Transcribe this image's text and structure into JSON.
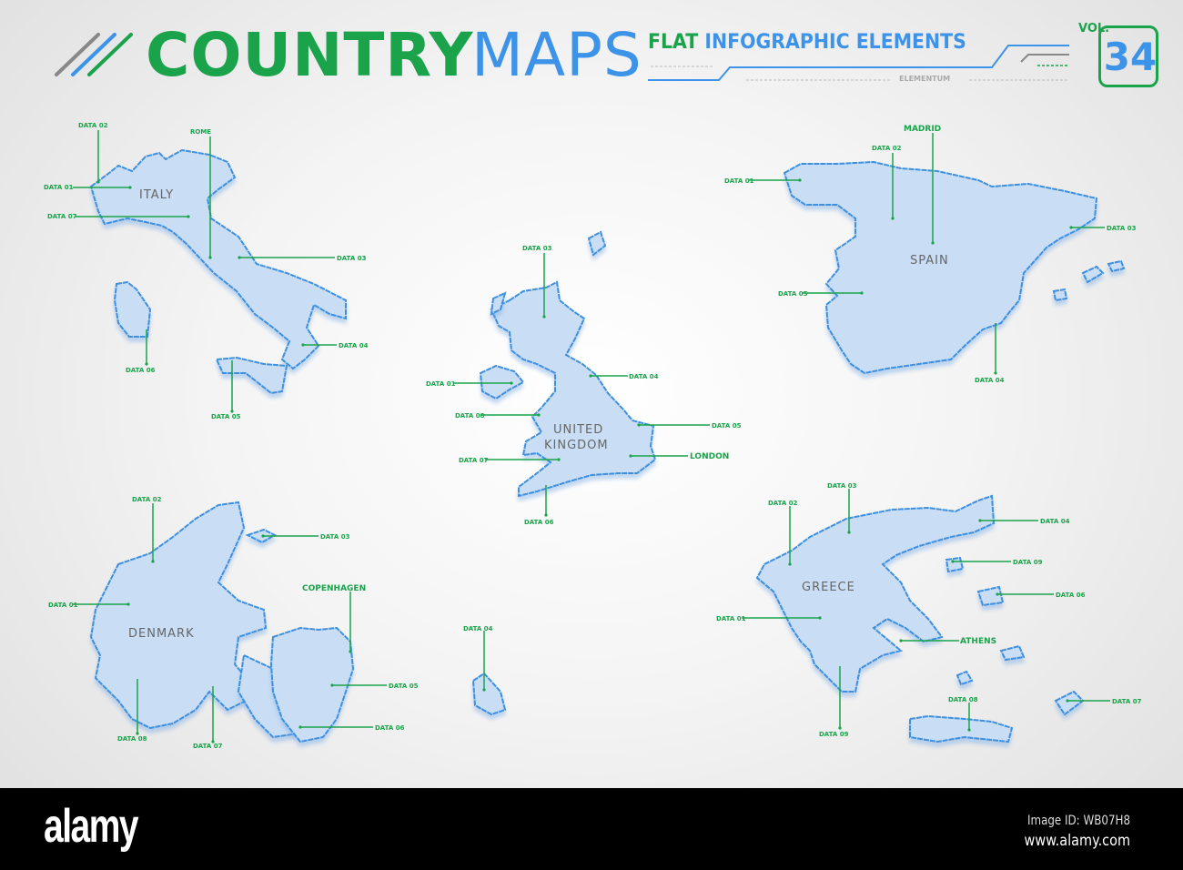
{
  "header": {
    "title_part1": "COUNTRY",
    "title_part2": "MAPS",
    "subtitle_green": "FLAT",
    "subtitle_blue": "INFOGRAPHIC ELEMENTS",
    "brand": "ELEMENTUM",
    "vol_label": "VOL.",
    "vol_number": "34"
  },
  "colors": {
    "green": "#1aa34a",
    "blue": "#3d93e8",
    "land": "#c9def5",
    "outline": "#3d8fe0"
  },
  "maps": [
    {
      "country": "ITALY",
      "labels": [
        "DATA 02",
        "DATA 01",
        "DATA 07",
        "ROME",
        "DATA 03",
        "DATA 04",
        "DATA 06",
        "DATA 05"
      ]
    },
    {
      "country_line1": "UNITED",
      "country_line2": "KINGDOM",
      "labels": [
        "DATA 03",
        "DATA 01",
        "DATA 04",
        "DATA 08",
        "DATA 05",
        "LONDON",
        "DATA 07",
        "DATA 06"
      ]
    },
    {
      "country": "SPAIN",
      "labels": [
        "MADRID",
        "DATA 02",
        "DATA 01",
        "DATA 03",
        "DATA 05",
        "DATA 04"
      ]
    },
    {
      "country": "DENMARK",
      "labels": [
        "DATA 02",
        "DATA 03",
        "DATA 01",
        "COPENHAGEN",
        "DATA 04",
        "DATA 05",
        "DATA 06",
        "DATA 08",
        "DATA 07"
      ]
    },
    {
      "country": "GREECE",
      "labels": [
        "DATA 03",
        "DATA 02",
        "DATA 04",
        "DATA 09",
        "DATA 06",
        "DATA 01",
        "ATHENS",
        "DATA 08",
        "DATA 07",
        "DATA 09"
      ]
    }
  ],
  "footer": {
    "logo": "alamy",
    "image_id": "Image ID: WB07H8",
    "url": "www.alamy.com"
  }
}
